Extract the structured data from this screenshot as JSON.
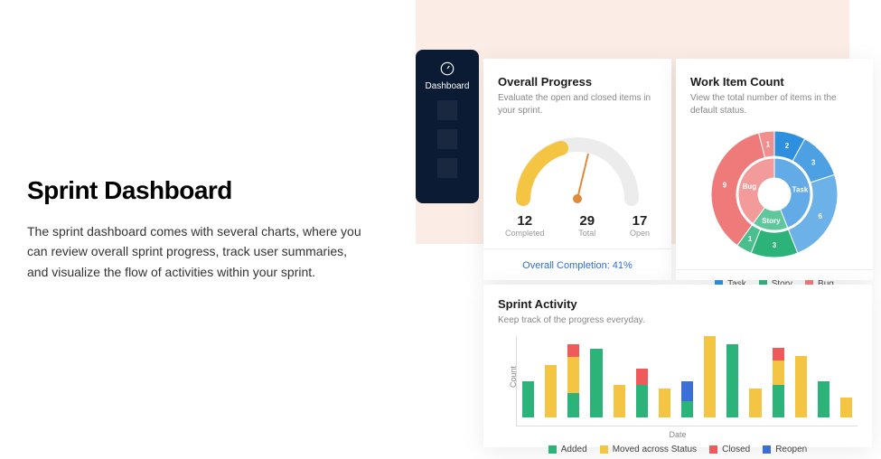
{
  "left": {
    "title": "Sprint Dashboard",
    "desc": "The sprint dashboard comes with several charts, where you can review overall sprint progress, track user summaries, and visualize the flow of activities within your sprint."
  },
  "sidebar": {
    "label": "Dashboard"
  },
  "progress": {
    "title": "Overall Progress",
    "sub": "Evaluate the open and closed items in your sprint.",
    "completed_num": "12",
    "completed_lbl": "Completed",
    "total_num": "29",
    "total_lbl": "Total",
    "open_num": "17",
    "open_lbl": "Open",
    "completion": "Overall Completion: 41%"
  },
  "work": {
    "title": "Work Item Count",
    "sub": "View the total number of items in the default status.",
    "legend": {
      "task": "Task",
      "story": "Story",
      "bug": "Bug"
    }
  },
  "activity": {
    "title": "Sprint Activity",
    "sub": "Keep track of the progress everyday.",
    "ylabel": "Count",
    "xlabel": "Date",
    "legend": {
      "added": "Added",
      "moved": "Moved across Status",
      "closed": "Closed",
      "reopen": "Reopen"
    }
  },
  "chart_data": {
    "gauge": {
      "type": "gauge",
      "completed": 12,
      "open": 17,
      "total": 29,
      "percent": 41
    },
    "work_items": {
      "type": "pie",
      "outer": [
        {
          "label": "2",
          "value": 2,
          "group": "Task"
        },
        {
          "label": "3",
          "value": 3,
          "group": "Task"
        },
        {
          "label": "6",
          "value": 6,
          "group": "Task"
        },
        {
          "label": "3",
          "value": 3,
          "group": "Story"
        },
        {
          "label": "1",
          "value": 1,
          "group": "Story"
        },
        {
          "label": "9",
          "value": 9,
          "group": "Bug"
        },
        {
          "label": "1",
          "value": 1,
          "group": "Bug"
        }
      ],
      "inner": [
        {
          "label": "Task",
          "value": 11
        },
        {
          "label": "Story",
          "value": 4
        },
        {
          "label": "Bug",
          "value": 10
        }
      ],
      "colors": {
        "Task": "#2d8fdd",
        "Story": "#2bb37a",
        "Bug": "#ef7a7a"
      }
    },
    "activity": {
      "type": "bar",
      "xlabel": "Date",
      "ylabel": "Count",
      "legend": [
        "Added",
        "Moved across Status",
        "Closed",
        "Reopen"
      ],
      "colors": {
        "Added": "#2bb37a",
        "Moved across Status": "#f4c542",
        "Closed": "#ef5a5a",
        "Reopen": "#3c6fd6"
      },
      "stacks": [
        {
          "Added": 22
        },
        {
          "Moved across Status": 32
        },
        {
          "Added": 15,
          "Moved across Status": 22,
          "Closed": 8
        },
        {
          "Added": 42
        },
        {
          "Moved across Status": 20
        },
        {
          "Added": 20,
          "Closed": 10
        },
        {
          "Moved across Status": 18
        },
        {
          "Added": 10,
          "Reopen": 12
        },
        {
          "Moved across Status": 50
        },
        {
          "Added": 45
        },
        {
          "Moved across Status": 18
        },
        {
          "Added": 20,
          "Moved across Status": 15,
          "Closed": 8
        },
        {
          "Moved across Status": 38
        },
        {
          "Added": 22
        },
        {
          "Moved across Status": 12
        }
      ]
    }
  }
}
